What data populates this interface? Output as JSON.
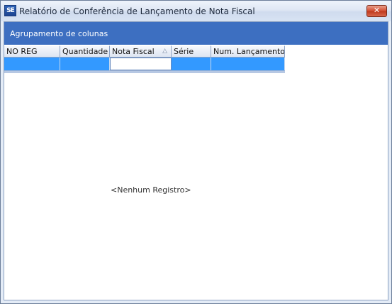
{
  "window": {
    "title": "Relatório de Conferência de Lançamento de Nota Fiscal",
    "icon": "app-logo-icon",
    "icon_text": "SE",
    "close_glyph": "✕"
  },
  "group_panel": {
    "text": "Agrupamento de colunas"
  },
  "grid": {
    "columns": [
      {
        "label": "NO REG"
      },
      {
        "label": "Quantidade"
      },
      {
        "label": "Nota Fiscal",
        "sort_glyph": "△"
      },
      {
        "label": "Série"
      },
      {
        "label": "Num. Lançamentos"
      }
    ],
    "empty_text": "<Nenhum Registro>"
  },
  "colors": {
    "group_panel": "#3d6fc1",
    "selected_row": "#3399ff",
    "close_button": "#c03a1f"
  }
}
